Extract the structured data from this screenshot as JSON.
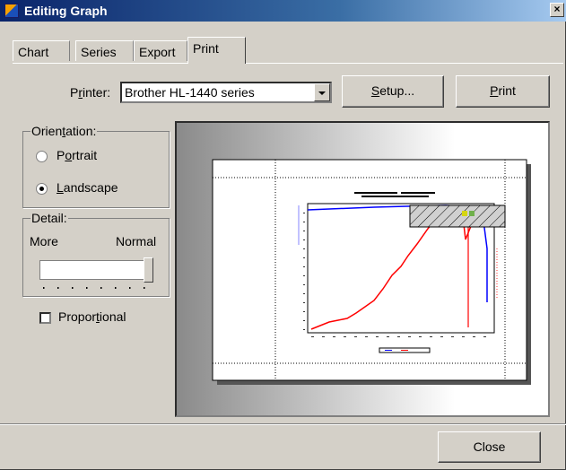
{
  "window": {
    "title": "Editing Graph",
    "close_glyph": "×"
  },
  "tabs": [
    {
      "label": "Chart"
    },
    {
      "label": "Series"
    },
    {
      "label": "Export"
    },
    {
      "label": "Print",
      "active": true
    }
  ],
  "printer": {
    "label_pre": "P",
    "label_u": "r",
    "label_post": "inter:",
    "selected": "Brother HL-1440 series"
  },
  "buttons": {
    "setup_u": "S",
    "setup_rest": "etup...",
    "print_u": "P",
    "print_rest": "rint",
    "close": "Close"
  },
  "orientation": {
    "title_pre": "Orien",
    "title_u": "t",
    "title_post": "ation:",
    "portrait_pre": "P",
    "portrait_u": "o",
    "portrait_post": "rtrait",
    "landscape_u": "L",
    "landscape_rest": "andscape",
    "selected": "landscape"
  },
  "detail": {
    "title": "Detail:",
    "left_label": "More",
    "right_label": "Normal",
    "level": 1.0
  },
  "proportional": {
    "pre": "Propor",
    "u": "t",
    "post": "ional",
    "checked": false
  },
  "colors": {
    "accent": "#0a246a",
    "face": "#d4d0c8",
    "chart_red": "#ff0000",
    "chart_blue": "#0000ff"
  },
  "icons": {
    "window": "app-chart-icon",
    "close": "close-icon",
    "dropdown": "chevron-down-icon"
  }
}
